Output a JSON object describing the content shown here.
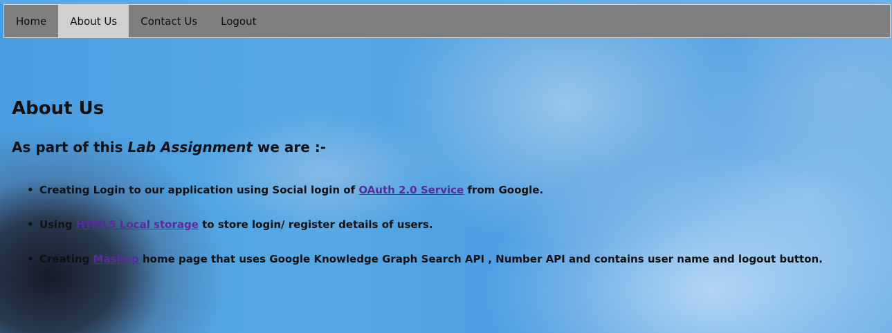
{
  "nav": {
    "items": [
      {
        "label": "Home",
        "active": false
      },
      {
        "label": "About Us",
        "active": true
      },
      {
        "label": "Contact Us",
        "active": false
      },
      {
        "label": "Logout",
        "active": false
      }
    ]
  },
  "main": {
    "title": "About Us",
    "subtitle_prefix": "As part of this ",
    "subtitle_emphasis": "Lab Assignment",
    "subtitle_suffix": " we are :-",
    "list": [
      {
        "prefix": "Creating Login to our application using Social login of ",
        "link": "OAuth 2.0 Service",
        "suffix": " from Google."
      },
      {
        "prefix": "Using ",
        "link": "HTML5 Local storage",
        "suffix": " to store login/ register details of users."
      },
      {
        "prefix": "Creating ",
        "link": "Mashup",
        "suffix": " home page that uses Google Knowledge Graph Search API , Number API and contains user name and logout button."
      }
    ]
  },
  "colors": {
    "nav_background": "#7f7f7f",
    "nav_active": "#d0d0d0",
    "link": "#5a2a9e",
    "background": "#4a9ee0"
  }
}
